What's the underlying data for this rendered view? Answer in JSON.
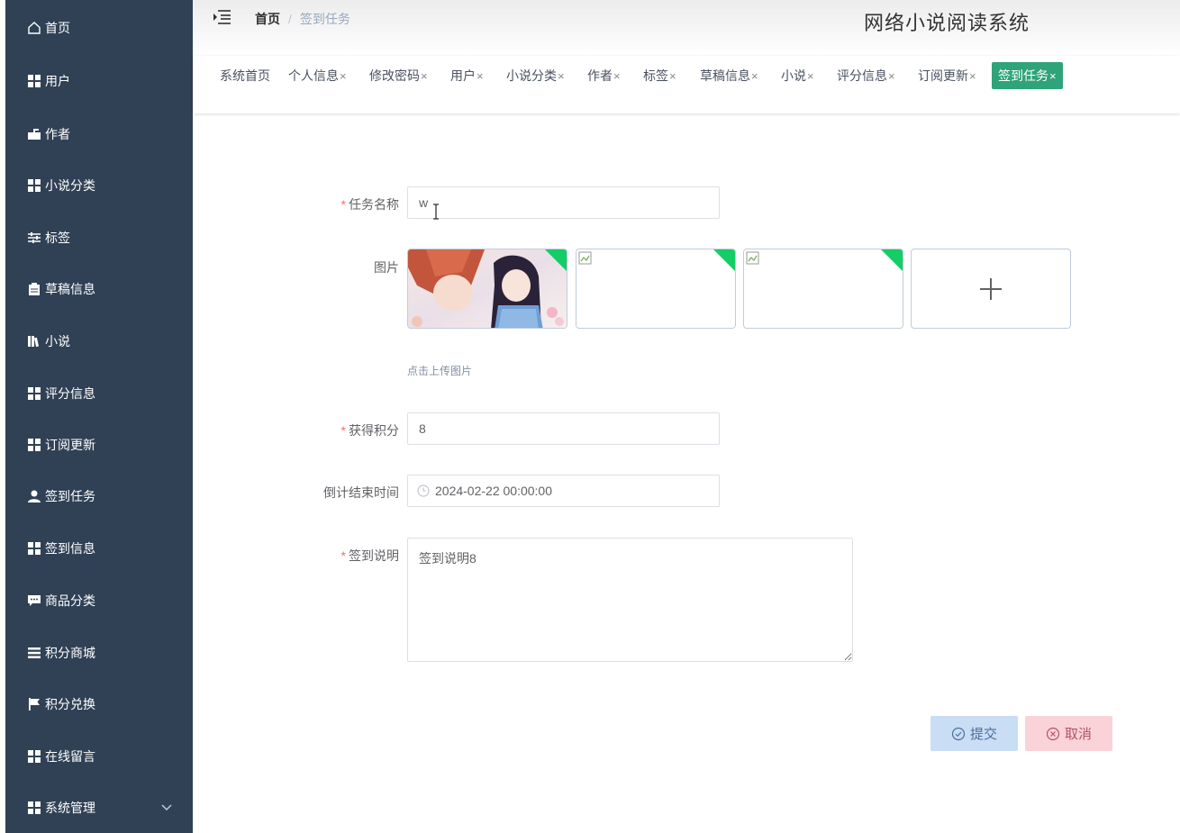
{
  "sidebar": {
    "items": [
      {
        "label": "首页",
        "icon": "home-icon"
      },
      {
        "label": "用户",
        "icon": "grid-icon"
      },
      {
        "label": "作者",
        "icon": "mailbox-icon"
      },
      {
        "label": "小说分类",
        "icon": "grid-icon"
      },
      {
        "label": "标签",
        "icon": "sliders-icon"
      },
      {
        "label": "草稿信息",
        "icon": "clipboard-icon"
      },
      {
        "label": "小说",
        "icon": "books-icon"
      },
      {
        "label": "评分信息",
        "icon": "grid-icon"
      },
      {
        "label": "订阅更新",
        "icon": "grid-icon"
      },
      {
        "label": "签到任务",
        "icon": "user-icon"
      },
      {
        "label": "签到信息",
        "icon": "grid-icon"
      },
      {
        "label": "商品分类",
        "icon": "chat-icon"
      },
      {
        "label": "积分商城",
        "icon": "list-icon"
      },
      {
        "label": "积分兑换",
        "icon": "flag-icon"
      },
      {
        "label": "在线留言",
        "icon": "grid-icon"
      },
      {
        "label": "系统管理",
        "icon": "grid-icon"
      }
    ]
  },
  "header": {
    "breadcrumb_home": "首页",
    "breadcrumb_separator": "/",
    "breadcrumb_current": "签到任务",
    "system_title": "网络小说阅读系统"
  },
  "tags": [
    {
      "label": "系统首页",
      "closable": false
    },
    {
      "label": "个人信息",
      "closable": true
    },
    {
      "label": "修改密码",
      "closable": true
    },
    {
      "label": "用户",
      "closable": true
    },
    {
      "label": "小说分类",
      "closable": true
    },
    {
      "label": "作者",
      "closable": true
    },
    {
      "label": "标签",
      "closable": true
    },
    {
      "label": "草稿信息",
      "closable": true
    },
    {
      "label": "小说",
      "closable": true
    },
    {
      "label": "评分信息",
      "closable": true
    },
    {
      "label": "订阅更新",
      "closable": true
    },
    {
      "label": "签到任务",
      "closable": true,
      "active": true
    }
  ],
  "tag_close_glyph": "×",
  "form": {
    "required_mark": "*",
    "task_name_label": "任务名称",
    "task_name_value": "w",
    "image_label": "图片",
    "upload_tip": "点击上传图片",
    "points_label": "获得积分",
    "points_value": "8",
    "deadline_label": "倒计结束时间",
    "deadline_value": "2024-02-22 00:00:00",
    "description_label": "签到说明",
    "description_value": "签到说明8"
  },
  "buttons": {
    "submit": "提交",
    "cancel": "取消"
  },
  "colors": {
    "sidebar_bg": "#304156",
    "active_tag": "#2fa37a",
    "upload_corner": "#13ce66",
    "required": "#f56c6c"
  }
}
